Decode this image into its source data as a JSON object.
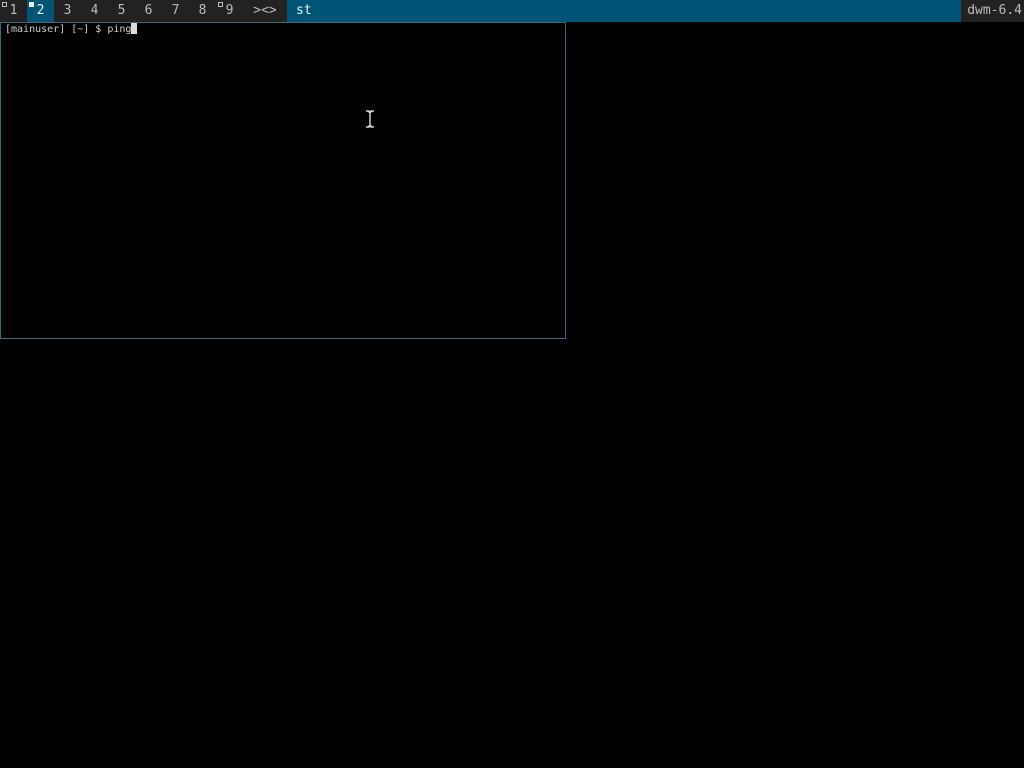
{
  "bar": {
    "tags": [
      {
        "label": "1",
        "occupied": true,
        "selected": false
      },
      {
        "label": "2",
        "occupied": true,
        "selected": true
      },
      {
        "label": "3",
        "occupied": false,
        "selected": false
      },
      {
        "label": "4",
        "occupied": false,
        "selected": false
      },
      {
        "label": "5",
        "occupied": false,
        "selected": false
      },
      {
        "label": "6",
        "occupied": false,
        "selected": false
      },
      {
        "label": "7",
        "occupied": false,
        "selected": false
      },
      {
        "label": "8",
        "occupied": false,
        "selected": false
      },
      {
        "label": "9",
        "occupied": true,
        "selected": false
      }
    ],
    "layout_symbol": "><>",
    "window_title": "st",
    "status_text": "dwm-6.4"
  },
  "terminal": {
    "prompt": "[mainuser] [~] $ ",
    "input": "ping"
  },
  "colors": {
    "bar_bg": "#222222",
    "selected_bg": "#005577",
    "bar_fg": "#bbbbbb",
    "selected_fg": "#eeeeee",
    "border": "#3a6a7a"
  },
  "icons": {
    "mouse_pointer": "i-beam-cursor-icon"
  }
}
